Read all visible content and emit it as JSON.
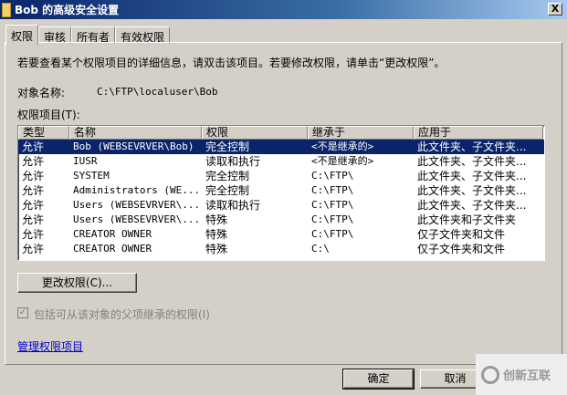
{
  "window": {
    "title": "Bob 的高级安全设置",
    "close": "X"
  },
  "tabs": [
    "权限",
    "审核",
    "所有者",
    "有效权限"
  ],
  "instructions": "若要查看某个权限项目的详细信息，请双击该项目。若要修改权限，请单击“更改权限”。",
  "object": {
    "label": "对象名称:",
    "value": "C:\\FTP\\localuser\\Bob"
  },
  "entries_label": "权限项目(T):",
  "columns": [
    "类型",
    "名称",
    "权限",
    "继承于",
    "应用于"
  ],
  "rows": [
    [
      "允许",
      "Bob (WEBSEVRVER\\Bob)",
      "完全控制",
      "<不是继承的>",
      "此文件夹、子文件夹..."
    ],
    [
      "允许",
      "IUSR",
      "读取和执行",
      "<不是继承的>",
      "此文件夹、子文件夹..."
    ],
    [
      "允许",
      "SYSTEM",
      "完全控制",
      "C:\\FTP\\",
      "此文件夹、子文件夹..."
    ],
    [
      "允许",
      "Administrators (WE...",
      "完全控制",
      "C:\\FTP\\",
      "此文件夹、子文件夹..."
    ],
    [
      "允许",
      "Users (WEBSEVRVER\\...",
      "读取和执行",
      "C:\\FTP\\",
      "此文件夹、子文件夹..."
    ],
    [
      "允许",
      "Users (WEBSEVRVER\\...",
      "特殊",
      "C:\\FTP\\",
      "此文件夹和子文件夹"
    ],
    [
      "允许",
      "CREATOR OWNER",
      "特殊",
      "C:\\FTP\\",
      "仅子文件夹和文件"
    ],
    [
      "允许",
      "CREATOR OWNER",
      "特殊",
      "C:\\",
      "仅子文件夹和文件"
    ]
  ],
  "change_button": "更改权限(C)...",
  "inherit_checkbox": {
    "label": "包括可从该对象的父项继承的权限(I)",
    "checked": true
  },
  "manage_link": "管理权限项目",
  "ok": "确定",
  "cancel": "取消",
  "watermark": "创新互联"
}
